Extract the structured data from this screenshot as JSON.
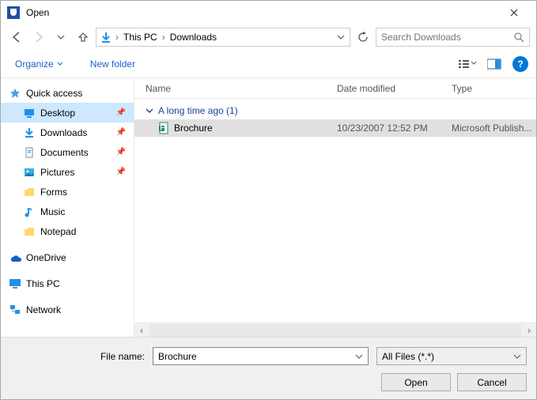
{
  "window": {
    "title": "Open"
  },
  "nav": {
    "breadcrumb": {
      "seg1": "This PC",
      "seg2": "Downloads"
    },
    "search_placeholder": "Search Downloads"
  },
  "toolbar": {
    "organize": "Organize",
    "new_folder": "New folder"
  },
  "sidebar": {
    "quick_access": "Quick access",
    "items": [
      {
        "label": "Desktop"
      },
      {
        "label": "Downloads"
      },
      {
        "label": "Documents"
      },
      {
        "label": "Pictures"
      },
      {
        "label": "Forms"
      },
      {
        "label": "Music"
      },
      {
        "label": "Notepad"
      }
    ],
    "onedrive": "OneDrive",
    "this_pc": "This PC",
    "network": "Network"
  },
  "columns": {
    "name": "Name",
    "date": "Date modified",
    "type": "Type"
  },
  "group": {
    "header": "A long time ago (1)"
  },
  "files": [
    {
      "name": "Brochure",
      "date": "10/23/2007 12:52 PM",
      "type": "Microsoft Publish..."
    }
  ],
  "footer": {
    "filename_label": "File name:",
    "filename_value": "Brochure",
    "filter": "All Files (*.*)",
    "open": "Open",
    "cancel": "Cancel"
  }
}
